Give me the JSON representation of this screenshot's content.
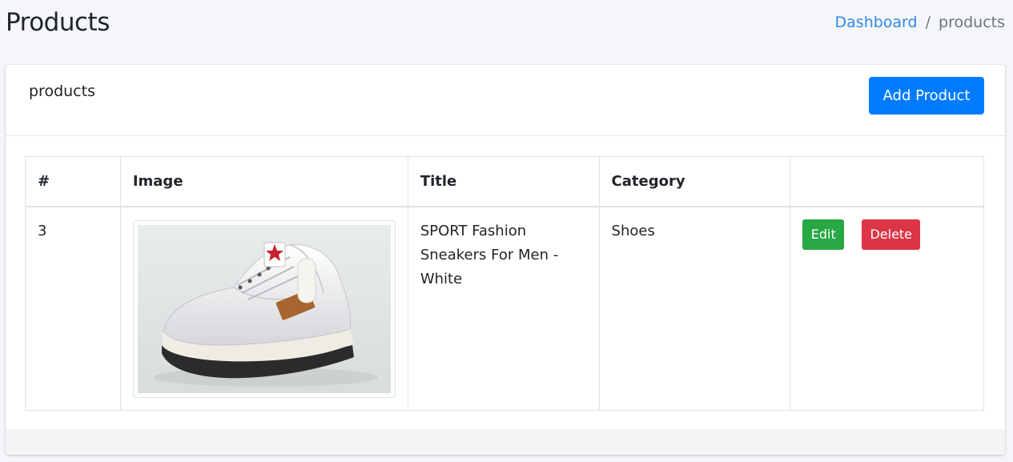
{
  "header": {
    "title": "Products",
    "breadcrumb": {
      "home_label": "Dashboard",
      "separator": "/",
      "current": "products"
    }
  },
  "card": {
    "title": "products",
    "add_button_label": "Add Product"
  },
  "table": {
    "columns": [
      "#",
      "Image",
      "Title",
      "Category",
      ""
    ],
    "rows": [
      {
        "id": "3",
        "image_icon": "shoe-image",
        "title": "SPORT Fashion Sneakers For Men - White",
        "category": "Shoes",
        "edit_label": "Edit",
        "delete_label": "Delete"
      }
    ]
  },
  "colors": {
    "primary": "#007bff",
    "success": "#28a745",
    "danger": "#dc3545",
    "link": "#3489e4",
    "background": "#f4f6f9"
  }
}
